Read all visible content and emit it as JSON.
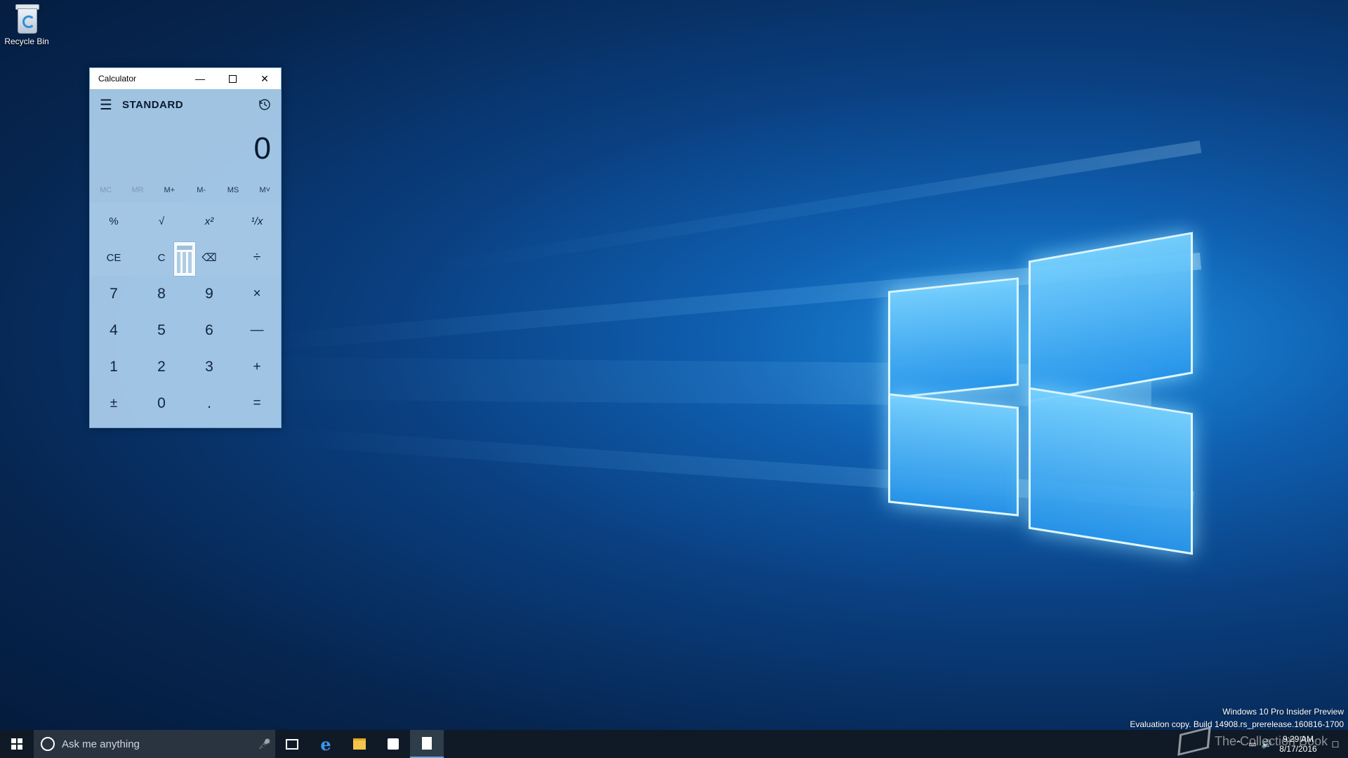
{
  "desktop": {
    "recycle_bin_label": "Recycle Bin",
    "watermark_line1": "Windows 10 Pro Insider Preview",
    "watermark_line2": "Evaluation copy. Build 14908.rs_prerelease.160816-1700",
    "brand_text": "The Collection Book"
  },
  "calculator": {
    "title": "Calculator",
    "mode": "STANDARD",
    "display_value": "0",
    "memory_buttons": [
      {
        "label": "MC",
        "enabled": false
      },
      {
        "label": "MR",
        "enabled": false
      },
      {
        "label": "M+",
        "enabled": true
      },
      {
        "label": "M-",
        "enabled": true
      },
      {
        "label": "MS",
        "enabled": true
      },
      {
        "label": "M˅",
        "enabled": true
      }
    ],
    "keys": {
      "percent": "%",
      "sqrt": "√",
      "square": "x²",
      "reciprocal": "¹/x",
      "ce": "CE",
      "c": "C",
      "backspace": "⌫",
      "divide": "÷",
      "seven": "7",
      "eight": "8",
      "nine": "9",
      "multiply": "×",
      "four": "4",
      "five": "5",
      "six": "6",
      "minus": "—",
      "one": "1",
      "two": "2",
      "three": "3",
      "plus": "+",
      "negate": "±",
      "zero": "0",
      "decimal": ".",
      "equals": "="
    }
  },
  "taskbar": {
    "search_placeholder": "Ask me anything",
    "clock_time": "9:29 AM",
    "clock_date": "8/17/2016",
    "apps": [
      "task-view",
      "edge",
      "file-explorer",
      "store",
      "calculator"
    ]
  },
  "colors": {
    "accent": "#0a64c8",
    "calc_background": "#aacdeb",
    "taskbar": "#101a26"
  }
}
